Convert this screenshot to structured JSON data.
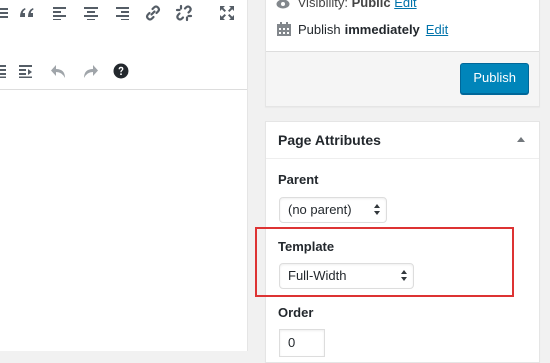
{
  "editor": {
    "toolbar_row1": [
      "blockquote-icon",
      "align-left-icon",
      "align-center-icon",
      "align-right-icon",
      "link-icon",
      "unlink-icon",
      "fullscreen-icon"
    ],
    "toolbar_row2": [
      "indent-icon",
      "outdent-icon",
      "undo-icon",
      "redo-icon",
      "help-icon"
    ]
  },
  "publish": {
    "visibility_label": "Visibility:",
    "visibility_value": "Public",
    "visibility_edit": "Edit",
    "publish_label": "Publish",
    "publish_value": "immediately",
    "publish_edit": "Edit",
    "publish_button": "Publish"
  },
  "page_attributes": {
    "title": "Page Attributes",
    "parent_label": "Parent",
    "parent_value": "(no parent)",
    "template_label": "Template",
    "template_value": "Full-Width",
    "order_label": "Order",
    "order_value": "0"
  },
  "colors": {
    "accent": "#0085ba",
    "link": "#0073aa",
    "highlight": "#dd3333"
  }
}
